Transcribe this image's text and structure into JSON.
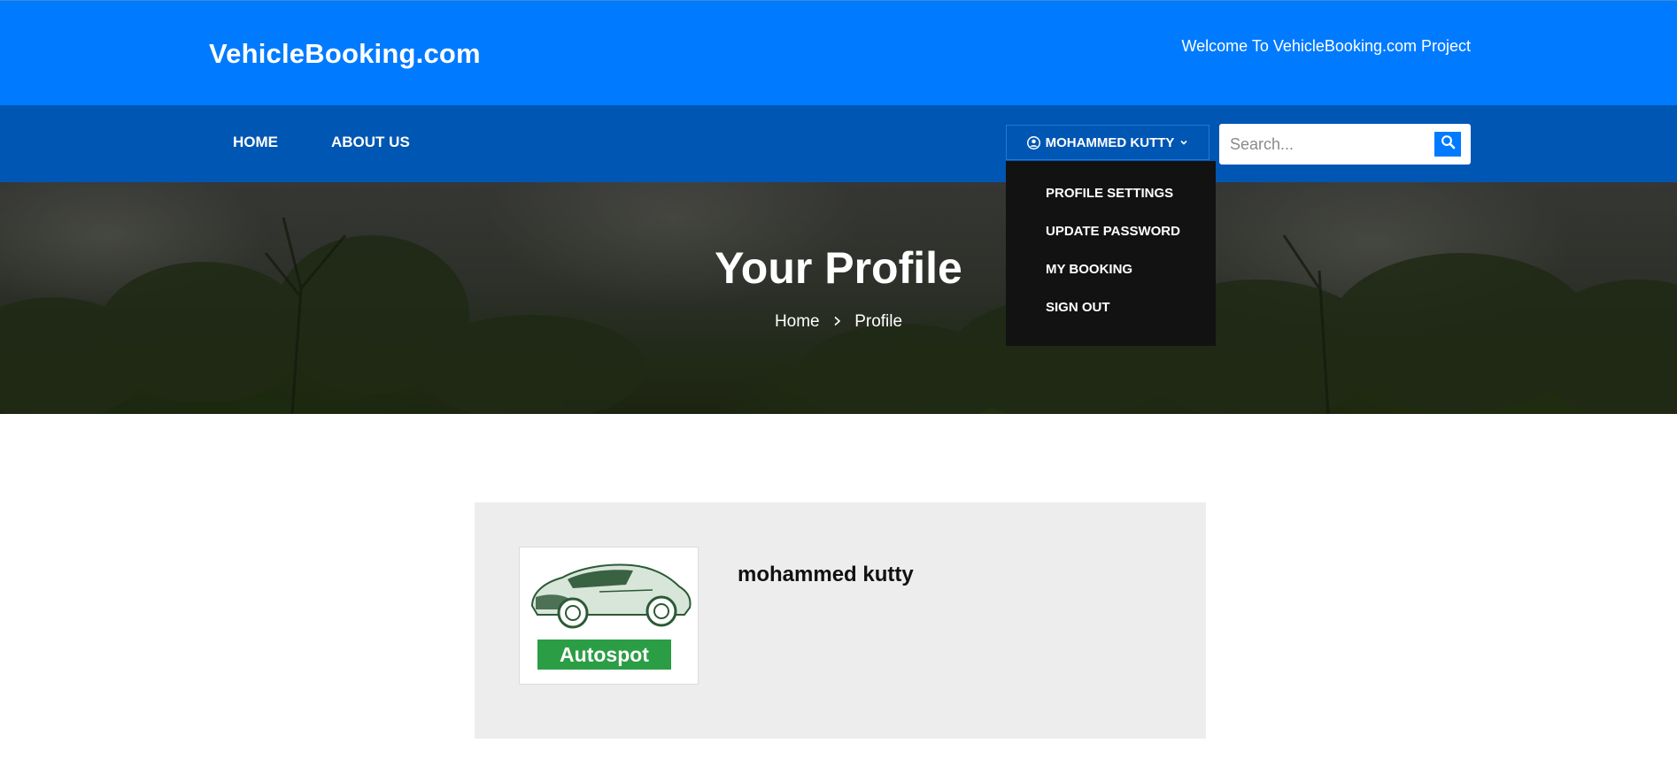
{
  "header": {
    "brand": "VehicleBooking.com",
    "welcome": "Welcome To VehicleBooking.com Project"
  },
  "nav": {
    "items": [
      {
        "label": "HOME"
      },
      {
        "label": "ABOUT US"
      }
    ],
    "user_menu_label": "MOHAMMED KUTTY",
    "search": {
      "placeholder": "Search...",
      "value": ""
    }
  },
  "dropdown": {
    "items": [
      {
        "label": "PROFILE SETTINGS"
      },
      {
        "label": "UPDATE PASSWORD"
      },
      {
        "label": "MY BOOKING"
      },
      {
        "label": "SIGN OUT"
      }
    ]
  },
  "hero": {
    "title": "Your Profile",
    "breadcrumb": {
      "home": "Home",
      "current": "Profile"
    }
  },
  "profile": {
    "name": "mohammed kutty",
    "avatar_logo_text": "Autospot"
  },
  "icons": {
    "user": "user-circle-icon",
    "caret": "chevron-down-icon",
    "search": "search-icon",
    "breadcrumb_separator": "chevron-right-icon"
  },
  "colors": {
    "primary": "#007bff",
    "nav": "#0056b3",
    "dropdown_bg": "#121212",
    "card_bg": "#ededed",
    "logo_green": "#2a9d45"
  }
}
